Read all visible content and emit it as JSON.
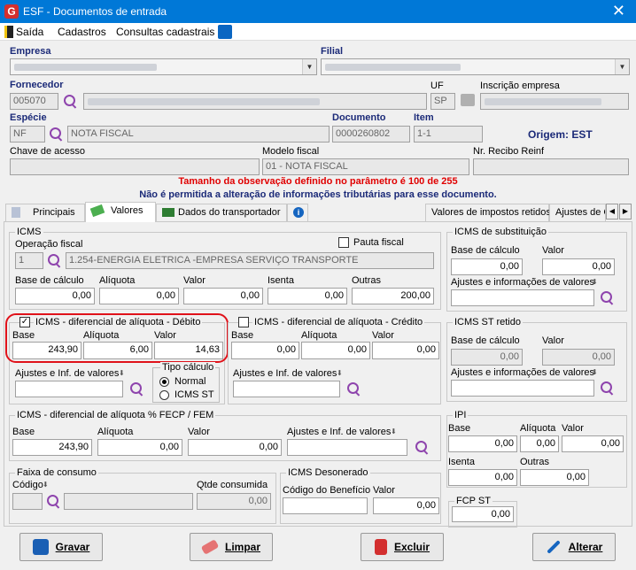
{
  "window": {
    "title": "ESF - Documentos de entrada",
    "close": "✕"
  },
  "menu": [
    "Saída",
    "Cadastros",
    "Consultas cadastrais"
  ],
  "header": {
    "empresa_label": "Empresa",
    "filial_label": "Filial",
    "fornecedor_label": "Fornecedor",
    "fornecedor_code": "005070",
    "uf_label": "UF",
    "uf_value": "SP",
    "inscricao_label": "Inscrição empresa",
    "especie_label": "Espécie",
    "especie_code": "NF",
    "especie_desc": "NOTA FISCAL",
    "documento_label": "Documento",
    "documento_value": "0000260802",
    "item_label": "Item",
    "item_value": "1-1",
    "origem": "Origem: EST",
    "chave_label": "Chave de acesso",
    "modelo_label": "Modelo fiscal",
    "modelo_value": "01 - NOTA FISCAL",
    "recibo_label": "Nr. Recibo Reinf"
  },
  "messages": {
    "warning": "Tamanho da observação definido no parâmetro é 100 de 255",
    "info": "Não é permitida a alteração de informações tributárias para esse documento."
  },
  "tabs": [
    "Principais",
    "Valores",
    "Dados do transportador",
    "Valores de impostos retidos",
    "Ajustes de C"
  ],
  "icms": {
    "title": "ICMS",
    "operacao_label": "Operação fiscal",
    "operacao_code": "1",
    "operacao_desc": "1.254-ENERGIA ELETRICA -EMPRESA SERVIÇO TRANSPORTE",
    "pauta_label": "Pauta fiscal",
    "base_label": "Base de cálculo",
    "aliquota_label": "Alíquota",
    "valor_label": "Valor",
    "isenta_label": "Isenta",
    "outras_label": "Outras",
    "base": "0,00",
    "aliquota": "0,00",
    "valor": "0,00",
    "isenta": "0,00",
    "outras": "200,00"
  },
  "difal_debito": {
    "title": "ICMS - diferencial de alíquota - Débito",
    "check": "✓",
    "base_label": "Base",
    "aliquota_label": "Alíquota",
    "valor_label": "Valor",
    "base": "243,90",
    "aliquota": "6,00",
    "valor": "14,63",
    "ajustes_label": "Ajustes e Inf. de valores",
    "tipo_label": "Tipo cálculo",
    "normal_label": "Normal",
    "st_label": "ICMS ST"
  },
  "difal_credito": {
    "title": "ICMS - diferencial de alíquota - Crédito",
    "base_label": "Base",
    "aliquota_label": "Alíquota",
    "valor_label": "Valor",
    "base": "0,00",
    "aliquota": "0,00",
    "valor": "0,00",
    "ajustes_label": "Ajustes e Inf. de valores"
  },
  "fecp": {
    "title": "ICMS - diferencial de alíquota % FECP / FEM",
    "base_label": "Base",
    "aliquota_label": "Alíquota",
    "valor_label": "Valor",
    "ajustes_label": "Ajustes e Inf. de valores",
    "base": "243,90",
    "aliquota": "0,00",
    "valor": "0,00"
  },
  "faixa": {
    "title": "Faixa de consumo",
    "codigo_label": "Código",
    "qtde_label": "Qtde consumida",
    "qtde": "0,00"
  },
  "desonerado": {
    "title": "ICMS Desonerado",
    "codigo_label": "Código do Benefício",
    "valor_label": "Valor",
    "valor": "0,00"
  },
  "subst": {
    "title": "ICMS de substituição",
    "base_label": "Base de cálculo",
    "valor_label": "Valor",
    "base": "0,00",
    "valor": "0,00",
    "ajustes_label": "Ajustes e informações de valores"
  },
  "st_retido": {
    "title": "ICMS ST retido",
    "base_label": "Base de cálculo",
    "valor_label": "Valor",
    "base": "0,00",
    "valor": "0,00",
    "ajustes_label": "Ajustes e informações de valores"
  },
  "ipi": {
    "title": "IPI",
    "base_label": "Base",
    "aliquota_label": "Alíquota",
    "valor_label": "Valor",
    "isenta_label": "Isenta",
    "outras_label": "Outras",
    "base": "0,00",
    "aliquota": "0,00",
    "valor": "0,00",
    "isenta": "0,00",
    "outras": "0,00"
  },
  "fcp_st": {
    "title": "FCP ST",
    "valor": "0,00"
  },
  "buttons": {
    "gravar": "Gravar",
    "limpar": "Limpar",
    "excluir": "Excluir",
    "alterar": "Alterar"
  }
}
